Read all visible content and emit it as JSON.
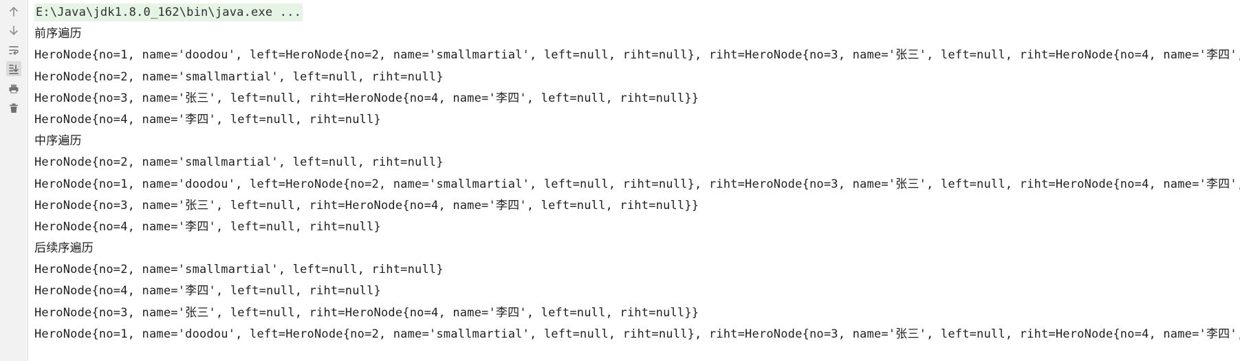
{
  "toolbar": {
    "buttons": [
      {
        "icon": "arrow-up-icon"
      },
      {
        "icon": "arrow-down-icon"
      },
      {
        "icon": "soft-wrap-icon"
      },
      {
        "icon": "scroll-to-end-icon"
      },
      {
        "icon": "print-icon"
      },
      {
        "icon": "trash-icon"
      }
    ],
    "colors": {
      "background": "#f2f2f2",
      "icon": "#8c8c8c",
      "active": "#dcdcdc"
    }
  },
  "console": {
    "command": "E:\\Java\\jdk1.8.0_162\\bin\\java.exe ...",
    "lines": [
      "前序遍历",
      "HeroNode{no=1, name='doodou', left=HeroNode{no=2, name='smallmartial', left=null, riht=null}, riht=HeroNode{no=3, name='张三', left=null, riht=HeroNode{no=4, name='李四', lef",
      "HeroNode{no=2, name='smallmartial', left=null, riht=null}",
      "HeroNode{no=3, name='张三', left=null, riht=HeroNode{no=4, name='李四', left=null, riht=null}}",
      "HeroNode{no=4, name='李四', left=null, riht=null}",
      "中序遍历",
      "HeroNode{no=2, name='smallmartial', left=null, riht=null}",
      "HeroNode{no=1, name='doodou', left=HeroNode{no=2, name='smallmartial', left=null, riht=null}, riht=HeroNode{no=3, name='张三', left=null, riht=HeroNode{no=4, name='李四', lef",
      "HeroNode{no=3, name='张三', left=null, riht=HeroNode{no=4, name='李四', left=null, riht=null}}",
      "HeroNode{no=4, name='李四', left=null, riht=null}",
      "后续序遍历",
      "HeroNode{no=2, name='smallmartial', left=null, riht=null}",
      "HeroNode{no=4, name='李四', left=null, riht=null}",
      "HeroNode{no=3, name='张三', left=null, riht=HeroNode{no=4, name='李四', left=null, riht=null}}",
      "HeroNode{no=1, name='doodou', left=HeroNode{no=2, name='smallmartial', left=null, riht=null}, riht=HeroNode{no=3, name='张三', left=null, riht=HeroNode{no=4, name='李四', lef"
    ]
  }
}
